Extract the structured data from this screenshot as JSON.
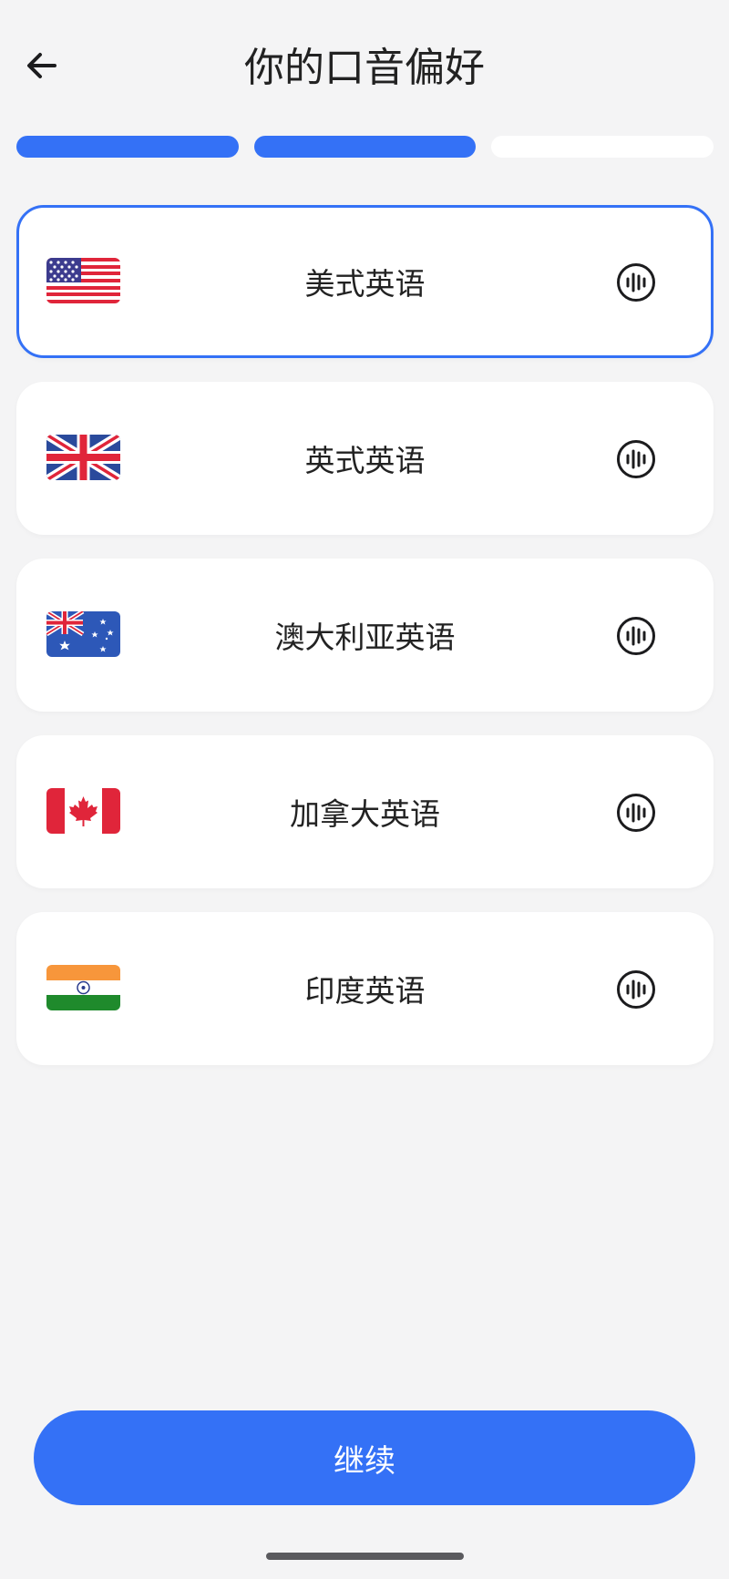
{
  "header": {
    "title": "你的口音偏好",
    "back_icon": "arrow-left-icon"
  },
  "progress": {
    "total_steps": 3,
    "completed_steps": 2,
    "active_color": "#3471f6",
    "inactive_color": "#ffffff"
  },
  "accents": [
    {
      "label": "美式英语",
      "flag": "us-flag-icon",
      "selected": true,
      "audio_icon": "audio-wave-icon"
    },
    {
      "label": "英式英语",
      "flag": "uk-flag-icon",
      "selected": false,
      "audio_icon": "audio-wave-icon"
    },
    {
      "label": "澳大利亚英语",
      "flag": "australia-flag-icon",
      "selected": false,
      "audio_icon": "audio-wave-icon"
    },
    {
      "label": "加拿大英语",
      "flag": "canada-flag-icon",
      "selected": false,
      "audio_icon": "audio-wave-icon"
    },
    {
      "label": "印度英语",
      "flag": "india-flag-icon",
      "selected": false,
      "audio_icon": "audio-wave-icon"
    }
  ],
  "footer": {
    "continue_label": "继续"
  },
  "colors": {
    "accent": "#3471f6",
    "background": "#f4f4f5",
    "card": "#ffffff"
  }
}
